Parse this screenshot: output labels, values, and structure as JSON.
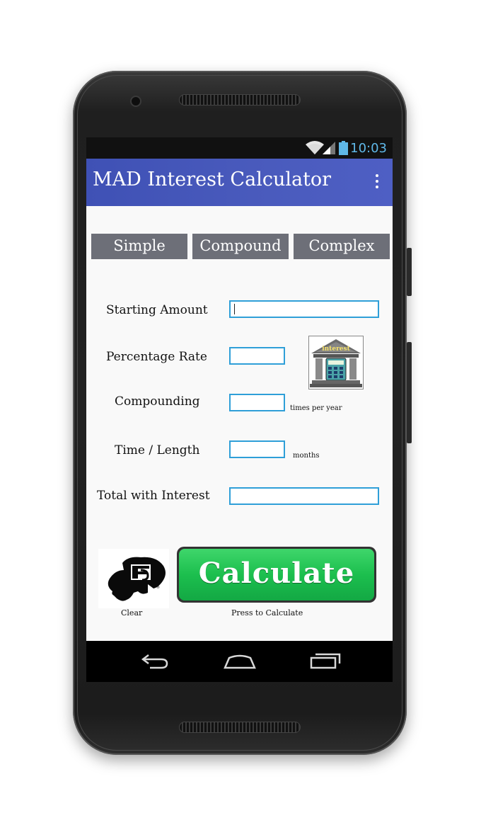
{
  "status_bar": {
    "time": "10:03"
  },
  "app_bar": {
    "title": "MAD Interest Calculator"
  },
  "tabs": [
    {
      "label": "Simple"
    },
    {
      "label": "Compound"
    },
    {
      "label": "Complex"
    }
  ],
  "form": {
    "starting_amount": {
      "label": "Starting Amount",
      "value": ""
    },
    "percentage_rate": {
      "label": "Percentage Rate",
      "value": ""
    },
    "compounding": {
      "label": "Compounding",
      "value": "",
      "unit": "times per year"
    },
    "time_length": {
      "label": "Time / Length",
      "value": "",
      "unit": "months"
    },
    "total_with_interest": {
      "label": "Total with Interest",
      "value": ""
    }
  },
  "bank_icon": {
    "text": "interest"
  },
  "actions": {
    "calculate_label": "Calculate",
    "calculate_caption": "Press to Calculate",
    "clear_caption": "Clear"
  },
  "colors": {
    "app_bar": "#3f51b5",
    "tab_background": "#6d6f78",
    "field_border": "#2f9fd8",
    "calculate_green": "#1cbf4e",
    "status_text": "#5fb8e8"
  }
}
